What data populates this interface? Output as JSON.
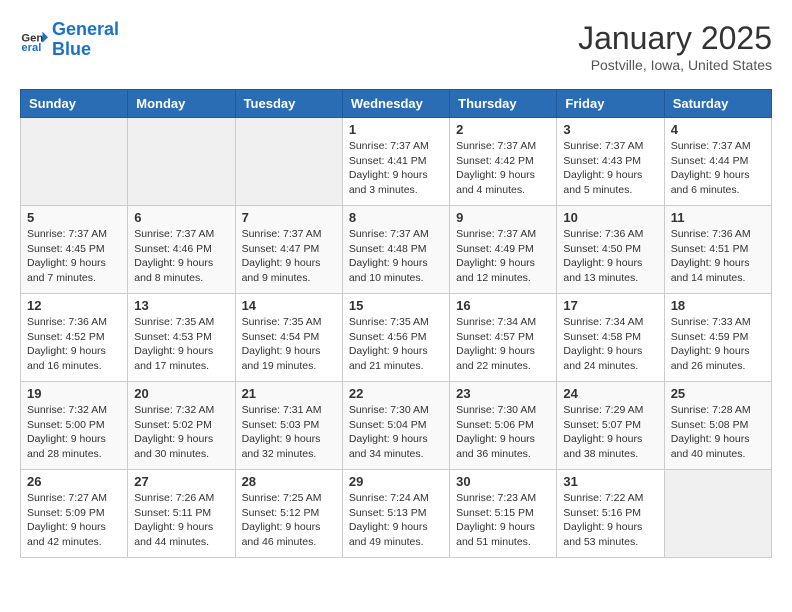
{
  "header": {
    "logo_line1": "General",
    "logo_line2": "Blue",
    "month": "January 2025",
    "location": "Postville, Iowa, United States"
  },
  "weekdays": [
    "Sunday",
    "Monday",
    "Tuesday",
    "Wednesday",
    "Thursday",
    "Friday",
    "Saturday"
  ],
  "weeks": [
    [
      {
        "day": "",
        "sunrise": "",
        "sunset": "",
        "daylight": ""
      },
      {
        "day": "",
        "sunrise": "",
        "sunset": "",
        "daylight": ""
      },
      {
        "day": "",
        "sunrise": "",
        "sunset": "",
        "daylight": ""
      },
      {
        "day": "1",
        "sunrise": "Sunrise: 7:37 AM",
        "sunset": "Sunset: 4:41 PM",
        "daylight": "Daylight: 9 hours and 3 minutes."
      },
      {
        "day": "2",
        "sunrise": "Sunrise: 7:37 AM",
        "sunset": "Sunset: 4:42 PM",
        "daylight": "Daylight: 9 hours and 4 minutes."
      },
      {
        "day": "3",
        "sunrise": "Sunrise: 7:37 AM",
        "sunset": "Sunset: 4:43 PM",
        "daylight": "Daylight: 9 hours and 5 minutes."
      },
      {
        "day": "4",
        "sunrise": "Sunrise: 7:37 AM",
        "sunset": "Sunset: 4:44 PM",
        "daylight": "Daylight: 9 hours and 6 minutes."
      }
    ],
    [
      {
        "day": "5",
        "sunrise": "Sunrise: 7:37 AM",
        "sunset": "Sunset: 4:45 PM",
        "daylight": "Daylight: 9 hours and 7 minutes."
      },
      {
        "day": "6",
        "sunrise": "Sunrise: 7:37 AM",
        "sunset": "Sunset: 4:46 PM",
        "daylight": "Daylight: 9 hours and 8 minutes."
      },
      {
        "day": "7",
        "sunrise": "Sunrise: 7:37 AM",
        "sunset": "Sunset: 4:47 PM",
        "daylight": "Daylight: 9 hours and 9 minutes."
      },
      {
        "day": "8",
        "sunrise": "Sunrise: 7:37 AM",
        "sunset": "Sunset: 4:48 PM",
        "daylight": "Daylight: 9 hours and 10 minutes."
      },
      {
        "day": "9",
        "sunrise": "Sunrise: 7:37 AM",
        "sunset": "Sunset: 4:49 PM",
        "daylight": "Daylight: 9 hours and 12 minutes."
      },
      {
        "day": "10",
        "sunrise": "Sunrise: 7:36 AM",
        "sunset": "Sunset: 4:50 PM",
        "daylight": "Daylight: 9 hours and 13 minutes."
      },
      {
        "day": "11",
        "sunrise": "Sunrise: 7:36 AM",
        "sunset": "Sunset: 4:51 PM",
        "daylight": "Daylight: 9 hours and 14 minutes."
      }
    ],
    [
      {
        "day": "12",
        "sunrise": "Sunrise: 7:36 AM",
        "sunset": "Sunset: 4:52 PM",
        "daylight": "Daylight: 9 hours and 16 minutes."
      },
      {
        "day": "13",
        "sunrise": "Sunrise: 7:35 AM",
        "sunset": "Sunset: 4:53 PM",
        "daylight": "Daylight: 9 hours and 17 minutes."
      },
      {
        "day": "14",
        "sunrise": "Sunrise: 7:35 AM",
        "sunset": "Sunset: 4:54 PM",
        "daylight": "Daylight: 9 hours and 19 minutes."
      },
      {
        "day": "15",
        "sunrise": "Sunrise: 7:35 AM",
        "sunset": "Sunset: 4:56 PM",
        "daylight": "Daylight: 9 hours and 21 minutes."
      },
      {
        "day": "16",
        "sunrise": "Sunrise: 7:34 AM",
        "sunset": "Sunset: 4:57 PM",
        "daylight": "Daylight: 9 hours and 22 minutes."
      },
      {
        "day": "17",
        "sunrise": "Sunrise: 7:34 AM",
        "sunset": "Sunset: 4:58 PM",
        "daylight": "Daylight: 9 hours and 24 minutes."
      },
      {
        "day": "18",
        "sunrise": "Sunrise: 7:33 AM",
        "sunset": "Sunset: 4:59 PM",
        "daylight": "Daylight: 9 hours and 26 minutes."
      }
    ],
    [
      {
        "day": "19",
        "sunrise": "Sunrise: 7:32 AM",
        "sunset": "Sunset: 5:00 PM",
        "daylight": "Daylight: 9 hours and 28 minutes."
      },
      {
        "day": "20",
        "sunrise": "Sunrise: 7:32 AM",
        "sunset": "Sunset: 5:02 PM",
        "daylight": "Daylight: 9 hours and 30 minutes."
      },
      {
        "day": "21",
        "sunrise": "Sunrise: 7:31 AM",
        "sunset": "Sunset: 5:03 PM",
        "daylight": "Daylight: 9 hours and 32 minutes."
      },
      {
        "day": "22",
        "sunrise": "Sunrise: 7:30 AM",
        "sunset": "Sunset: 5:04 PM",
        "daylight": "Daylight: 9 hours and 34 minutes."
      },
      {
        "day": "23",
        "sunrise": "Sunrise: 7:30 AM",
        "sunset": "Sunset: 5:06 PM",
        "daylight": "Daylight: 9 hours and 36 minutes."
      },
      {
        "day": "24",
        "sunrise": "Sunrise: 7:29 AM",
        "sunset": "Sunset: 5:07 PM",
        "daylight": "Daylight: 9 hours and 38 minutes."
      },
      {
        "day": "25",
        "sunrise": "Sunrise: 7:28 AM",
        "sunset": "Sunset: 5:08 PM",
        "daylight": "Daylight: 9 hours and 40 minutes."
      }
    ],
    [
      {
        "day": "26",
        "sunrise": "Sunrise: 7:27 AM",
        "sunset": "Sunset: 5:09 PM",
        "daylight": "Daylight: 9 hours and 42 minutes."
      },
      {
        "day": "27",
        "sunrise": "Sunrise: 7:26 AM",
        "sunset": "Sunset: 5:11 PM",
        "daylight": "Daylight: 9 hours and 44 minutes."
      },
      {
        "day": "28",
        "sunrise": "Sunrise: 7:25 AM",
        "sunset": "Sunset: 5:12 PM",
        "daylight": "Daylight: 9 hours and 46 minutes."
      },
      {
        "day": "29",
        "sunrise": "Sunrise: 7:24 AM",
        "sunset": "Sunset: 5:13 PM",
        "daylight": "Daylight: 9 hours and 49 minutes."
      },
      {
        "day": "30",
        "sunrise": "Sunrise: 7:23 AM",
        "sunset": "Sunset: 5:15 PM",
        "daylight": "Daylight: 9 hours and 51 minutes."
      },
      {
        "day": "31",
        "sunrise": "Sunrise: 7:22 AM",
        "sunset": "Sunset: 5:16 PM",
        "daylight": "Daylight: 9 hours and 53 minutes."
      },
      {
        "day": "",
        "sunrise": "",
        "sunset": "",
        "daylight": ""
      }
    ]
  ]
}
